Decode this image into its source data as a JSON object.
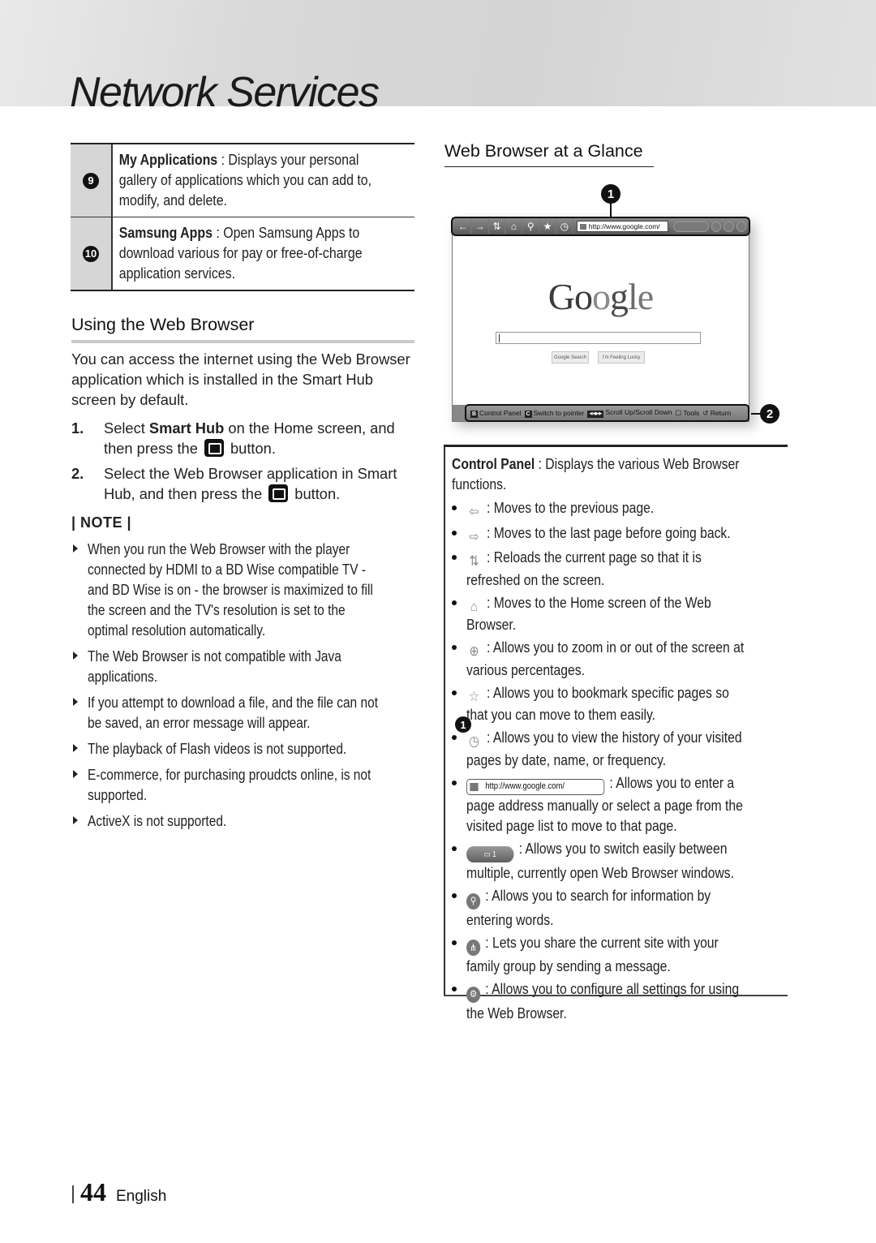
{
  "header": {
    "title": "Network Services"
  },
  "apps_table": {
    "rows": [
      {
        "number": "9",
        "term": "My Applications",
        "description": " : Displays your personal gallery of applications which you can add to, modify, and delete."
      },
      {
        "number": "10",
        "term": "Samsung Apps",
        "description": " : Open Samsung Apps to download various for pay or free-of-charge application services."
      }
    ]
  },
  "using_section": {
    "heading": "Using the Web Browser",
    "intro": "You can access the internet using the Web Browser application which is installed in the Smart Hub screen by default.",
    "steps": [
      {
        "number": "1.",
        "before": "Select ",
        "bold": "Smart Hub",
        "middle": " on the Home screen, and then press the ",
        "after": " button."
      },
      {
        "number": "2.",
        "before": "Select the Web Browser application in Smart Hub, and then press the ",
        "after": " button."
      }
    ],
    "note_label": "| NOTE |",
    "notes": [
      "When you run the Web Browser with the player connected by HDMI to a BD Wise compatible TV - and BD Wise is on - the browser is maximized to fill the screen and the TV's resolution is set to the optimal resolution automatically.",
      "The Web Browser is not compatible with Java applications.",
      "If you attempt to download a file, and the file can not be saved, an error message will appear.",
      "The playback of Flash videos is not supported.",
      "E-commerce, for purchasing proudcts online, is not supported.",
      "ActiveX is not supported."
    ]
  },
  "glance_section": {
    "heading": "Web Browser at a Glance",
    "callouts": [
      "1",
      "2"
    ],
    "browser": {
      "toolbar_icons": [
        "back-arrow-icon",
        "forward-arrow-icon",
        "reload-icon",
        "home-icon",
        "zoom-icon",
        "bookmark-star-icon",
        "history-icon"
      ],
      "url": "http://www.google.com/",
      "logo": "Google",
      "search_button": "Google Search",
      "lucky_button": "I'm Feeling Lucky",
      "status_items": [
        {
          "key": "B",
          "label": "Control Panel"
        },
        {
          "key": "C",
          "label": "Switch to pointer"
        },
        {
          "key": "◀◀▶▶",
          "label": "Scroll Up/Scroll Down"
        },
        {
          "key": "☐",
          "label": "Tools"
        },
        {
          "key": "↺",
          "label": "Return"
        }
      ]
    }
  },
  "control_panel": {
    "number": "1",
    "term": "Control Panel",
    "description": " : Displays the various Web Browser functions.",
    "items": [
      {
        "icon": "back-arrow-icon",
        "glyph": "⇦",
        "text": " : Moves to the previous page."
      },
      {
        "icon": "forward-arrow-icon",
        "glyph": "⇨",
        "text": " : Moves to the last page before going back."
      },
      {
        "icon": "reload-icon",
        "glyph": "⇅",
        "text": " : Reloads the current page so that it is refreshed on the screen."
      },
      {
        "icon": "home-icon",
        "glyph": "⌂",
        "text": " : Moves to the Home screen of the Web Browser."
      },
      {
        "icon": "zoom-icon",
        "glyph": "⊕",
        "text": " : Allows you to zoom in or out of the screen at various percentages."
      },
      {
        "icon": "bookmark-star-icon",
        "glyph": "☆",
        "text": " : Allows you to bookmark specific pages so that you can move to them easily."
      },
      {
        "icon": "history-icon",
        "glyph": "◷",
        "text": " : Allows you to view the history of your visited pages by date, name, or frequency."
      },
      {
        "icon": "url-field-icon",
        "glyph": "http://www.google.com/",
        "text": " : Allows you to enter a page address manually or select a page from the visited page list to move to that page."
      },
      {
        "icon": "window-switch-icon",
        "glyph": "▭ 1",
        "text": " : Allows you to switch easily between multiple, currently open Web Browser windows."
      },
      {
        "icon": "search-icon",
        "glyph": "⚲",
        "text": " : Allows you to search for information by entering words."
      },
      {
        "icon": "share-icon",
        "glyph": "⋔",
        "text": " : Lets you share the current site with your family group by sending a message."
      },
      {
        "icon": "settings-gear-icon",
        "glyph": "⚙",
        "text": " : Allows you to configure all settings for using the Web Browser."
      }
    ]
  },
  "footer": {
    "page_number": "44",
    "language": "English"
  }
}
